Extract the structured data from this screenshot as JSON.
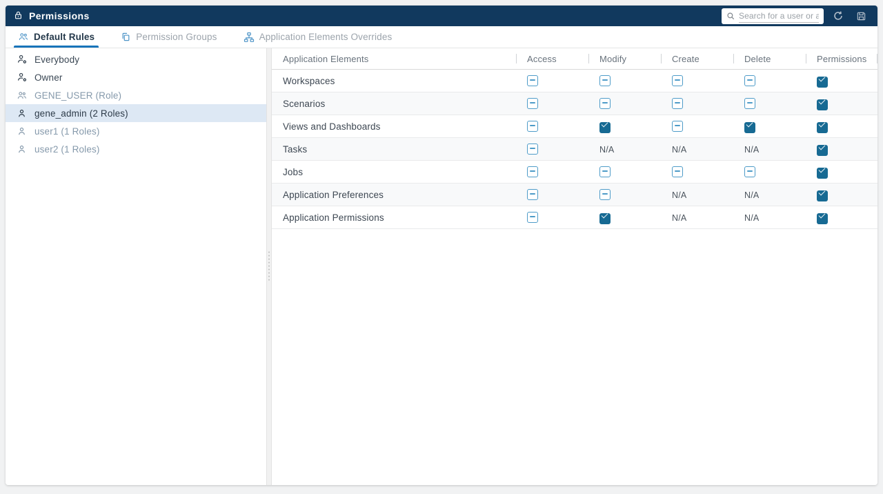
{
  "header": {
    "title": "Permissions",
    "search_placeholder": "Search for a user or a",
    "icons": [
      "lock-icon",
      "search-icon",
      "refresh-icon",
      "save-icon"
    ]
  },
  "tabs": [
    {
      "label": "Default Rules",
      "icon": "team-icon",
      "active": true
    },
    {
      "label": "Permission Groups",
      "icon": "copy-icon",
      "active": false
    },
    {
      "label": "Application Elements Overrides",
      "icon": "hierarchy-icon",
      "active": false
    }
  ],
  "sidebar": {
    "items": [
      {
        "label": "Everybody",
        "icon": "user-gear-icon",
        "muted": false,
        "selected": false
      },
      {
        "label": "Owner",
        "icon": "user-gear-icon",
        "muted": false,
        "selected": false
      },
      {
        "label": "GENE_USER (Role)",
        "icon": "team-icon",
        "muted": true,
        "selected": false
      },
      {
        "label": "gene_admin (2 Roles)",
        "icon": "user-icon",
        "muted": false,
        "selected": true
      },
      {
        "label": "user1 (1 Roles)",
        "icon": "user-icon",
        "muted": true,
        "selected": false
      },
      {
        "label": "user2 (1 Roles)",
        "icon": "user-icon",
        "muted": true,
        "selected": false
      }
    ]
  },
  "table": {
    "columns": [
      "Application Elements",
      "Access",
      "Modify",
      "Create",
      "Delete",
      "Permissions"
    ],
    "na_label": "N/A",
    "rows": [
      {
        "name": "Workspaces",
        "states": [
          "indeterminate",
          "indeterminate",
          "indeterminate",
          "indeterminate",
          "checked"
        ]
      },
      {
        "name": "Scenarios",
        "states": [
          "indeterminate",
          "indeterminate",
          "indeterminate",
          "indeterminate",
          "checked"
        ]
      },
      {
        "name": "Views and Dashboards",
        "states": [
          "indeterminate",
          "checked",
          "indeterminate",
          "checked",
          "checked"
        ]
      },
      {
        "name": "Tasks",
        "states": [
          "indeterminate",
          "na",
          "na",
          "na",
          "checked"
        ]
      },
      {
        "name": "Jobs",
        "states": [
          "indeterminate",
          "indeterminate",
          "indeterminate",
          "indeterminate",
          "checked"
        ]
      },
      {
        "name": "Application Preferences",
        "states": [
          "indeterminate",
          "indeterminate",
          "na",
          "na",
          "checked"
        ]
      },
      {
        "name": "Application Permissions",
        "states": [
          "indeterminate",
          "checked",
          "na",
          "na",
          "checked"
        ]
      }
    ]
  },
  "colors": {
    "header_bg": "#11395e",
    "accent": "#1874ba",
    "checkbox_checked": "#176a93",
    "checkbox_indeterminate": "#4d9bc8",
    "selected_item_bg": "#dde8f4",
    "tab_icon_blue": "#4d94c7"
  }
}
